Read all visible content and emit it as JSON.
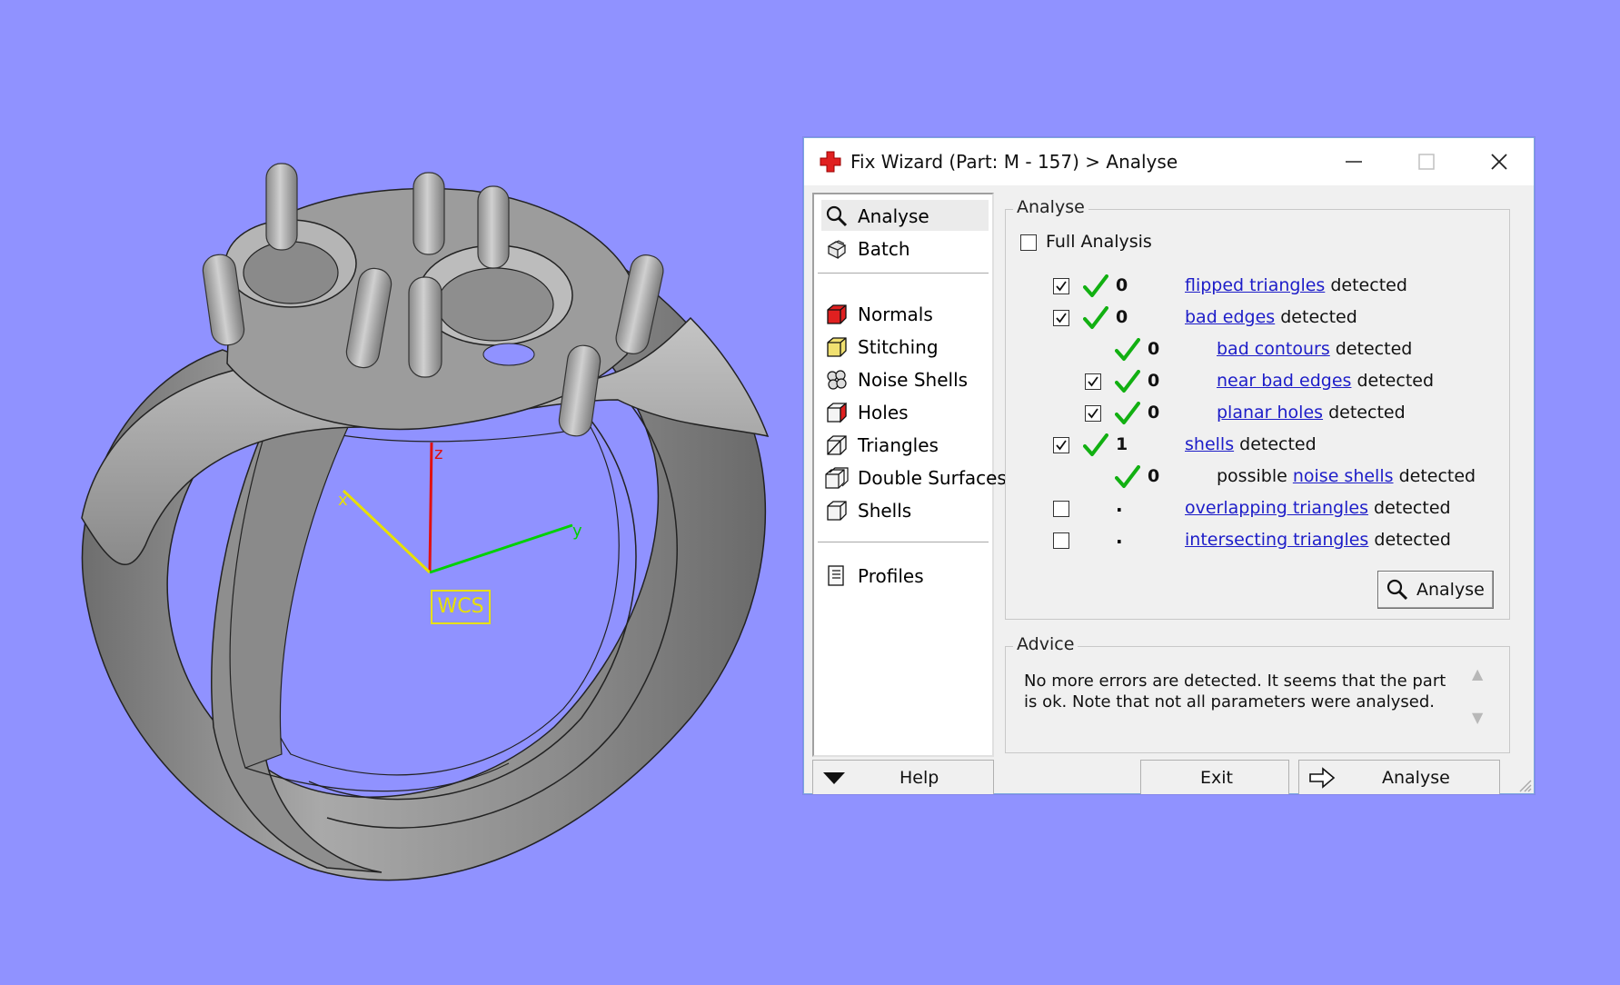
{
  "viewport": {
    "axis_labels": {
      "z": "z",
      "x": "x",
      "y": "y"
    },
    "wcs_label": "WCS",
    "colors": {
      "background": "#9092ff",
      "axis_z": "#e01010",
      "axis_x": "#e8e000",
      "axis_y": "#00d000",
      "model": "#9a9a9a"
    }
  },
  "dialog": {
    "title": "Fix Wizard (Part: M - 157) > Analyse",
    "nav": {
      "top_items": [
        {
          "label": "Analyse",
          "icon": "magnifier-icon",
          "selected": true
        },
        {
          "label": "Batch",
          "icon": "batch-icon",
          "selected": false
        }
      ],
      "fix_items": [
        {
          "label": "Normals",
          "icon": "normals-cube-icon"
        },
        {
          "label": "Stitching",
          "icon": "stitching-cube-icon"
        },
        {
          "label": "Noise Shells",
          "icon": "noise-shells-icon"
        },
        {
          "label": "Holes",
          "icon": "holes-cube-icon"
        },
        {
          "label": "Triangles",
          "icon": "triangles-cube-icon"
        },
        {
          "label": "Double Surfaces",
          "icon": "double-surfaces-icon"
        },
        {
          "label": "Shells",
          "icon": "shells-cube-icon"
        }
      ],
      "profiles_label": "Profiles"
    },
    "analyse": {
      "group_title": "Analyse",
      "full_analysis_label": "Full Analysis",
      "full_analysis_checked": false,
      "rows": [
        {
          "checkbox": true,
          "checked": true,
          "status": "ok",
          "count": "0",
          "prefix": "",
          "link": "flipped triangles",
          "suffix": "detected",
          "indent": 0
        },
        {
          "checkbox": true,
          "checked": true,
          "status": "ok",
          "count": "0",
          "prefix": "",
          "link": "bad edges",
          "suffix": "detected",
          "indent": 0
        },
        {
          "checkbox": false,
          "checked": false,
          "status": "ok",
          "count": "0",
          "prefix": "",
          "link": "bad contours",
          "suffix": "detected",
          "indent": 1
        },
        {
          "checkbox": true,
          "checked": true,
          "status": "ok",
          "count": "0",
          "prefix": "",
          "link": "near bad edges",
          "suffix": "detected",
          "indent": 1
        },
        {
          "checkbox": true,
          "checked": true,
          "status": "ok",
          "count": "0",
          "prefix": "",
          "link": "planar holes",
          "suffix": "detected",
          "indent": 1
        },
        {
          "checkbox": true,
          "checked": true,
          "status": "ok",
          "count": "1",
          "prefix": "",
          "link": "shells",
          "suffix": "detected",
          "indent": 0
        },
        {
          "checkbox": false,
          "checked": false,
          "status": "ok",
          "count": "0",
          "prefix": "possible",
          "link": "noise shells",
          "suffix": "detected",
          "indent": 1
        },
        {
          "checkbox": true,
          "checked": false,
          "status": "none",
          "count": ".",
          "prefix": "",
          "link": "overlapping triangles",
          "suffix": "detected",
          "indent": 0
        },
        {
          "checkbox": true,
          "checked": false,
          "status": "none",
          "count": ".",
          "prefix": "",
          "link": "intersecting triangles",
          "suffix": "detected",
          "indent": 0
        }
      ],
      "analyse_button": "Analyse"
    },
    "advice": {
      "group_title": "Advice",
      "text": "No more errors are detected. It seems that the part is ok. Note that not all parameters were analysed."
    },
    "bottom": {
      "help_label": "Help",
      "exit_label": "Exit",
      "analyse_label": "Analyse"
    },
    "colors": {
      "link": "#1d1dc8",
      "check_green": "#12b012",
      "title_icon_red": "#e02020"
    }
  }
}
